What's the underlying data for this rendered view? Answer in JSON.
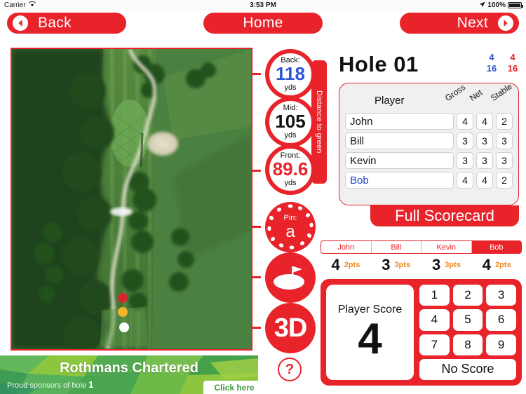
{
  "statusbar": {
    "carrier": "Carrier",
    "wifi_icon": "wifi-icon",
    "time": "3:53 PM",
    "location_icon": "location-arrow-icon",
    "battery_percent": "100%",
    "battery_icon": "battery-full-icon"
  },
  "nav": {
    "back_label": "Back",
    "back_icon": "chevron-left-circle-icon",
    "home_label": "Home",
    "next_label": "Next",
    "next_icon": "chevron-right-circle-icon"
  },
  "aerial": {
    "name": "hole-aerial-photo",
    "tee_markers": [
      "red-tee-marker",
      "yellow-tee-marker",
      "white-tee-marker"
    ]
  },
  "distances": {
    "rail_label": "Distance to green",
    "back": {
      "caption": "Back:",
      "value": "118",
      "unit": "yds",
      "color": "#2d56d6"
    },
    "mid": {
      "caption": "Mid:",
      "value": "105",
      "unit": "yds",
      "color": "#111111"
    },
    "front": {
      "caption": "Front:",
      "value": "89.6",
      "unit": "yds",
      "color": "#e8232a"
    },
    "pin": {
      "caption": "Pin:",
      "value": "a"
    }
  },
  "rail_buttons": {
    "green_view_icon": "green-flag-icon",
    "three_d_label": "3D",
    "help_label": "?"
  },
  "hole": {
    "title": "Hole 01",
    "par_blue": "4",
    "par_red": "4",
    "index_blue": "16",
    "index_red": "16"
  },
  "scorecard": {
    "player_header": "Player",
    "columns": [
      "Gross",
      "Net",
      "Stable"
    ],
    "rows": [
      {
        "name": "John",
        "gross": "4",
        "net": "4",
        "stable": "2",
        "selected": false
      },
      {
        "name": "Bill",
        "gross": "3",
        "net": "3",
        "stable": "3",
        "selected": false
      },
      {
        "name": "Kevin",
        "gross": "3",
        "net": "3",
        "stable": "3",
        "selected": false
      },
      {
        "name": "Bob",
        "gross": "4",
        "net": "4",
        "stable": "2",
        "selected": true
      }
    ],
    "full_scorecard_label": "Full Scorecard"
  },
  "player_tabs": [
    {
      "label": "John",
      "active": false
    },
    {
      "label": "Bill",
      "active": false
    },
    {
      "label": "Kevin",
      "active": false
    },
    {
      "label": "Bob",
      "active": true
    }
  ],
  "player_points": [
    {
      "score": "4",
      "points": "2pts"
    },
    {
      "score": "3",
      "points": "3pts"
    },
    {
      "score": "3",
      "points": "3pts"
    },
    {
      "score": "4",
      "points": "2pts"
    }
  ],
  "keypad": {
    "score_title": "Player Score",
    "score_value": "4",
    "keys": [
      "1",
      "2",
      "3",
      "4",
      "5",
      "6",
      "7",
      "8",
      "9"
    ],
    "no_score_label": "No Score"
  },
  "sponsor": {
    "title": "Rothmans Chartered",
    "subtitle": "Proud sponsors of hole",
    "hole_number": "1",
    "click_label": "Click here"
  },
  "colors": {
    "brand_red": "#e8232a",
    "blue": "#2d56d6",
    "orange": "#f08a1c",
    "green": "#3e9e3e"
  }
}
